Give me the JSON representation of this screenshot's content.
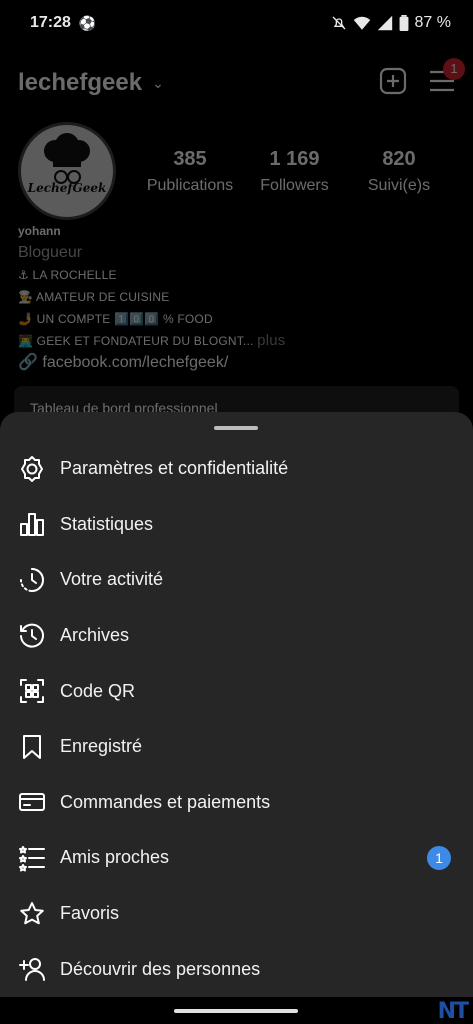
{
  "status_bar": {
    "time": "17:28",
    "battery": "87 %"
  },
  "profile": {
    "username": "lechefgeek",
    "notification_count": "1",
    "avatar_logo_text": "LechefGeek",
    "stats": [
      {
        "value": "385",
        "label": "Publications"
      },
      {
        "value": "1 169",
        "label": "Followers"
      },
      {
        "value": "820",
        "label": "Suivi(e)s"
      }
    ],
    "name": "yohann",
    "category": "Blogueur",
    "bio_lines": [
      "⚓ LA ROCHELLE",
      "👨‍🍳 AMATEUR DE CUISINE",
      "🤳 UN COMPTE 1️⃣0️⃣0️⃣ % FOOD"
    ],
    "bio_truncated": "👨‍💻 GEEK ET FONDATEUR DU BLOGNT...",
    "more_label": "plus",
    "link": "facebook.com/lechefgeek/",
    "dashboard_card": "Tableau de bord professionnel"
  },
  "sheet": {
    "items": [
      {
        "label": "Paramètres et confidentialité",
        "icon": "gear-icon"
      },
      {
        "label": "Statistiques",
        "icon": "bar-chart-icon"
      },
      {
        "label": "Votre activité",
        "icon": "activity-clock-icon"
      },
      {
        "label": "Archives",
        "icon": "archive-history-icon"
      },
      {
        "label": "Code QR",
        "icon": "qr-code-icon"
      },
      {
        "label": "Enregistré",
        "icon": "bookmark-icon"
      },
      {
        "label": "Commandes et paiements",
        "icon": "credit-card-icon"
      },
      {
        "label": "Amis proches",
        "icon": "close-friends-list-icon",
        "badge": "1"
      },
      {
        "label": "Favoris",
        "icon": "star-icon"
      },
      {
        "label": "Découvrir des personnes",
        "icon": "add-person-icon"
      }
    ]
  },
  "watermark": "NT",
  "colors": {
    "sheet_bg": "#262626",
    "badge_blue": "#3d8ae6",
    "notification_red": "#e0252f"
  }
}
